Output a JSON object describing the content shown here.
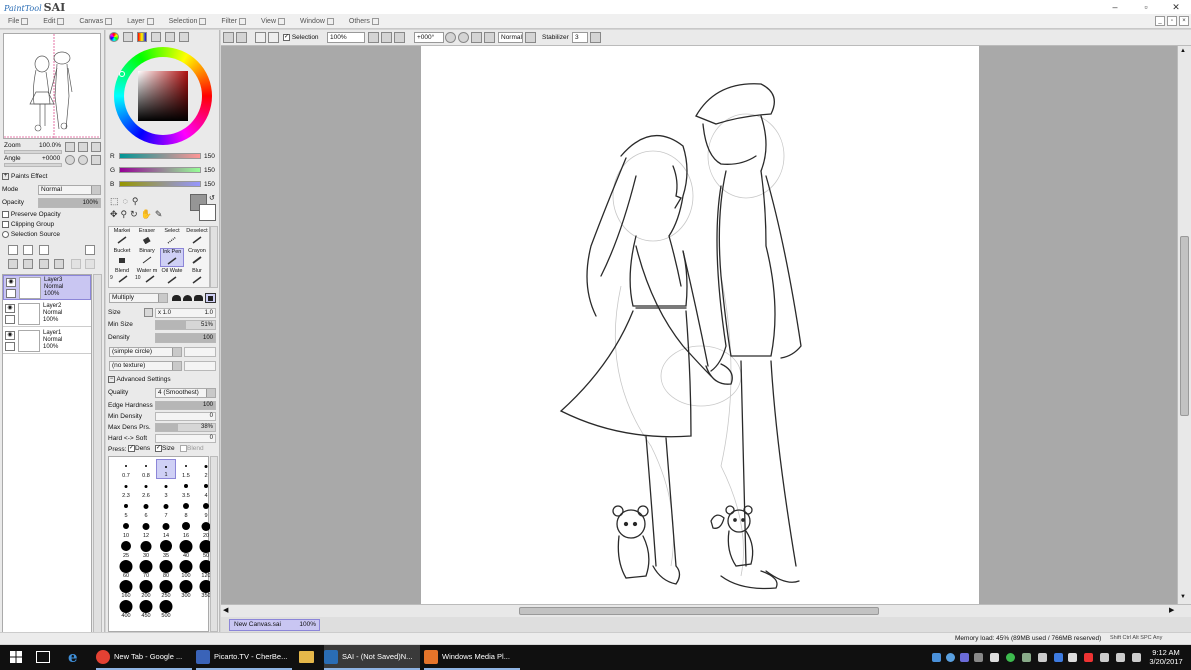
{
  "app": {
    "logo_small": "PaintTool",
    "logo_big": "SAI"
  },
  "window_controls": {
    "minimize": "–",
    "maximize": "▫",
    "close": "✕"
  },
  "menu": [
    {
      "label": "File"
    },
    {
      "label": "Edit"
    },
    {
      "label": "Canvas"
    },
    {
      "label": "Layer"
    },
    {
      "label": "Selection"
    },
    {
      "label": "Filter"
    },
    {
      "label": "View"
    },
    {
      "label": "Window"
    },
    {
      "label": "Others"
    }
  ],
  "navigator": {
    "zoom_label": "Zoom",
    "zoom_value": "100.0%",
    "angle_label": "Angle",
    "angle_value": "+0000"
  },
  "layer_panel": {
    "paints_effect": "Paints Effect",
    "mode_label": "Mode",
    "mode_value": "Normal",
    "opacity_label": "Opacity",
    "opacity_value": "100%",
    "preserve_opacity": "Preserve Opacity",
    "clipping_group": "Clipping Group",
    "selection_source": "Selection Source",
    "layers": [
      {
        "name": "Layer3",
        "mode": "Normal",
        "opacity": "100%",
        "selected": true
      },
      {
        "name": "Layer2",
        "mode": "Normal",
        "opacity": "100%",
        "selected": false
      },
      {
        "name": "Layer1",
        "mode": "Normal",
        "opacity": "100%",
        "selected": false
      }
    ]
  },
  "color": {
    "r_label": "R",
    "r_value": "150",
    "g_label": "G",
    "g_value": "150",
    "b_label": "B",
    "b_value": "150",
    "primary_color": "#969696",
    "hue_accent": "#b01010"
  },
  "tools": [
    {
      "label": "Markei"
    },
    {
      "label": "Eraser"
    },
    {
      "label": "Select"
    },
    {
      "label": "Deselect"
    },
    {
      "label": "Bucket"
    },
    {
      "label": "Binary"
    },
    {
      "label": "Ink Pen",
      "active": true
    },
    {
      "label": "Crayon"
    },
    {
      "label": "Blend",
      "num": "9"
    },
    {
      "label": "Water m",
      "num": "10"
    },
    {
      "label": "Oil Wate"
    },
    {
      "label": "Blur"
    }
  ],
  "brush": {
    "blend_mode": "Multiply",
    "size_label": "Size",
    "size_mult": "x 1.0",
    "size_value": "1.0",
    "min_size_label": "Min Size",
    "min_size_value": "51%",
    "density_label": "Density",
    "density_value": "100",
    "shape": "(simple circle)",
    "texture": "(no texture)",
    "advanced_settings": "Advanced Settings",
    "quality_label": "Quality",
    "quality_value": "4 (Smoothest)",
    "edge_hardness_label": "Edge Hardness",
    "edge_hardness_value": "100",
    "min_density_label": "Min Density",
    "min_density_value": "0",
    "max_dens_prs_label": "Max Dens Prs.",
    "max_dens_prs_value": "38%",
    "hard_soft_label": "Hard <-> Soft",
    "hard_soft_value": "0",
    "press_label": "Press:",
    "press_dens": "Dens",
    "press_size": "Size",
    "press_blend": "Blend"
  },
  "brush_sizes": [
    "0.7",
    "0.8",
    "1",
    "1.5",
    "2",
    "2.3",
    "2.6",
    "3",
    "3.5",
    "4",
    "5",
    "6",
    "7",
    "8",
    "9",
    "10",
    "12",
    "14",
    "16",
    "20",
    "25",
    "30",
    "35",
    "40",
    "50",
    "60",
    "70",
    "80",
    "100",
    "120",
    "160",
    "200",
    "250",
    "300",
    "350",
    "400",
    "450",
    "500"
  ],
  "canvas_toolbar": {
    "selection_label": "Selection",
    "zoom_value": "100%",
    "rotation_value": "+000°",
    "blend_mode": "Normal",
    "stabilizer_label": "Stabilizer",
    "stabilizer_value": "3"
  },
  "document_tab": {
    "name": "New Canvas.sai",
    "zoom": "100%"
  },
  "status": {
    "memory": "Memory load: 45% (89MB used / 766MB reserved)",
    "keys": [
      "Shift",
      "Ctrl",
      "Alt",
      "SPC",
      "Any"
    ]
  },
  "taskbar": {
    "items": [
      {
        "label": "New Tab - Google ...",
        "color": "#e34133"
      },
      {
        "label": "Picarto.TV - CherBe...",
        "color": "#3a63b8"
      },
      {
        "label": "SAI - (Not Saved)N...",
        "color": "#2a6db5"
      },
      {
        "label": "Windows Media Pl...",
        "color": "#e5742a"
      }
    ],
    "time": "9:12 AM",
    "date": "3/20/2017"
  }
}
